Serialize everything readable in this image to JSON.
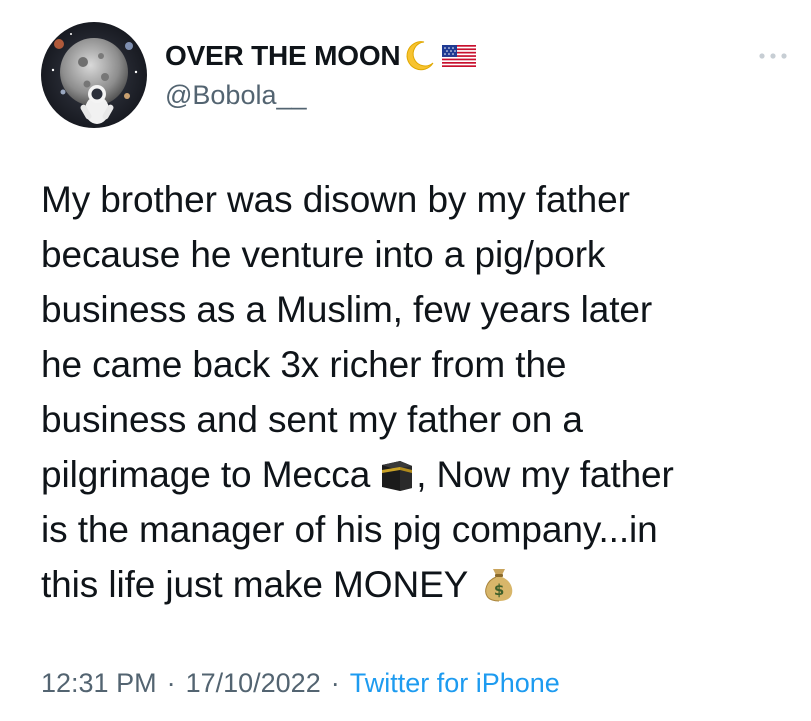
{
  "author": {
    "display_name": "OVER THE MOON",
    "handle": "@Bobola__",
    "badges": [
      "crescent-moon-emoji",
      "us-flag-emoji"
    ]
  },
  "tweet": {
    "lines": [
      {
        "text": "My brother was disown by my father"
      },
      {
        "text": "because he venture into a pig/pork"
      },
      {
        "text": "business as a Muslim, few years later"
      },
      {
        "text": "he came back 3x richer from the"
      },
      {
        "text": "business and sent my father on a"
      },
      {
        "before": "pilgrimage to Mecca",
        "emoji": "kaaba-icon",
        "after": ", Now my father"
      },
      {
        "text": "is the manager of his pig company...in"
      },
      {
        "before": "this life just make MONEY",
        "emoji": "money-bag-icon"
      }
    ]
  },
  "meta": {
    "time": "12:31 PM",
    "separator": "·",
    "date": "17/10/2022",
    "source": "Twitter for iPhone"
  },
  "colors": {
    "text": "#0f1419",
    "secondary": "#536471",
    "link": "#1d9bf0"
  },
  "icons": {
    "more": "more-options-icon",
    "avatar": "astronaut-moon-avatar"
  }
}
